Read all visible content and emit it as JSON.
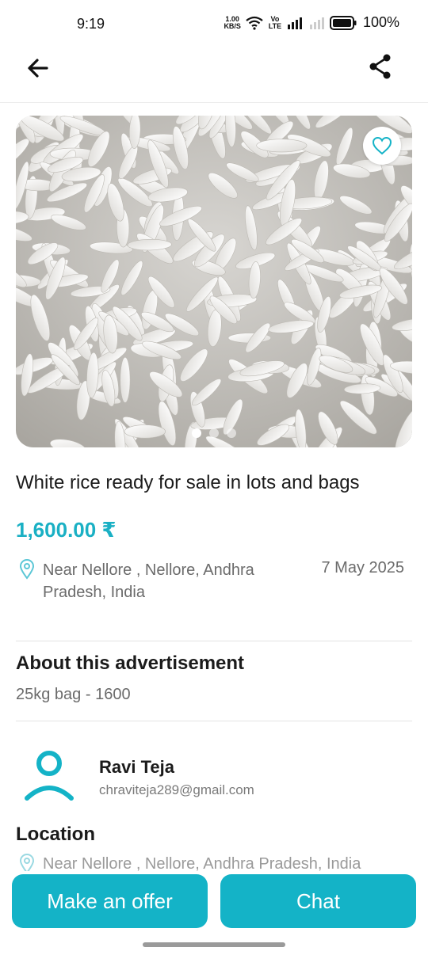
{
  "status_bar": {
    "time": "9:19",
    "net_speed_value": "1.00",
    "net_speed_unit": "KB/S",
    "volte": "Vo LTE",
    "battery": "100%"
  },
  "app_bar": {
    "back_icon": "arrow-left-icon",
    "share_icon": "share-icon"
  },
  "carousel": {
    "favorite_icon": "heart-outline-icon",
    "image_count": 3,
    "active_index": 0
  },
  "listing": {
    "title": "White rice ready for sale in lots and bags",
    "price": "1,600.00 ₹",
    "location": "Near Nellore , Nellore, Andhra Pradesh, India",
    "date": "7 May 2025"
  },
  "about": {
    "heading": "About this advertisement",
    "description": "25kg bag - 1600"
  },
  "seller": {
    "name": "Ravi Teja",
    "email": "chraviteja289@gmail.com"
  },
  "location_section": {
    "heading": "Location",
    "address": "Near Nellore , Nellore, Andhra Pradesh, India"
  },
  "actions": {
    "offer_label": "Make an offer",
    "chat_label": "Chat"
  },
  "colors": {
    "accent": "#14b3c7",
    "price": "#1ab0c4"
  }
}
